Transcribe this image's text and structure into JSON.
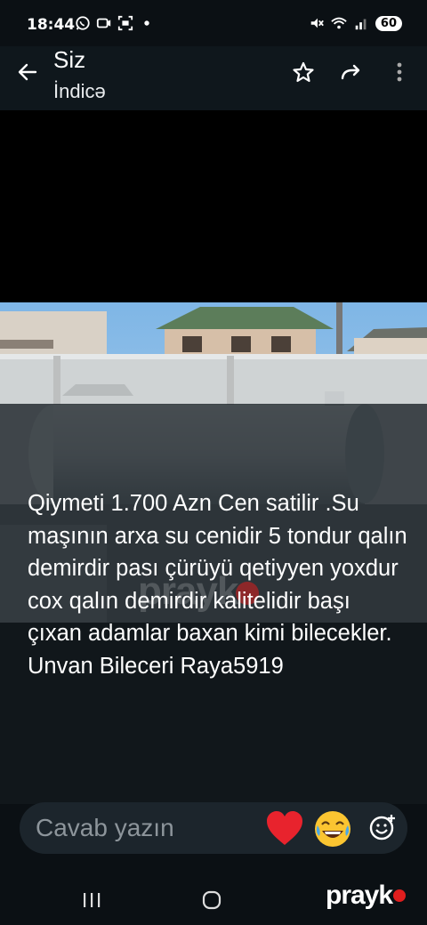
{
  "status": {
    "time": "18:44",
    "battery": "60",
    "left_icons": [
      "whatsapp-icon",
      "camera-icon",
      "screenshot-icon",
      "dot-icon"
    ],
    "right_icons": [
      "mute-icon",
      "wifi-icon",
      "signal-icon"
    ]
  },
  "header": {
    "title": "Siz",
    "subtitle": "İndicə"
  },
  "story": {
    "caption": "Qiymeti 1.700 Azn Cen satilir .Su maşının arxa su cenidir 5 tondur qalın demirdir pası çürüyü qetiyyen yoxdur cox qalın demirdir kalitelidir başı çıxan adamlar baxan kimi bilecekler. Unvan Bileceri Raya5919",
    "watermark": "prayk"
  },
  "reply": {
    "placeholder": "Cavab yazın"
  },
  "brand": {
    "logo_text": "prayk",
    "accent": "#e01e1e"
  }
}
